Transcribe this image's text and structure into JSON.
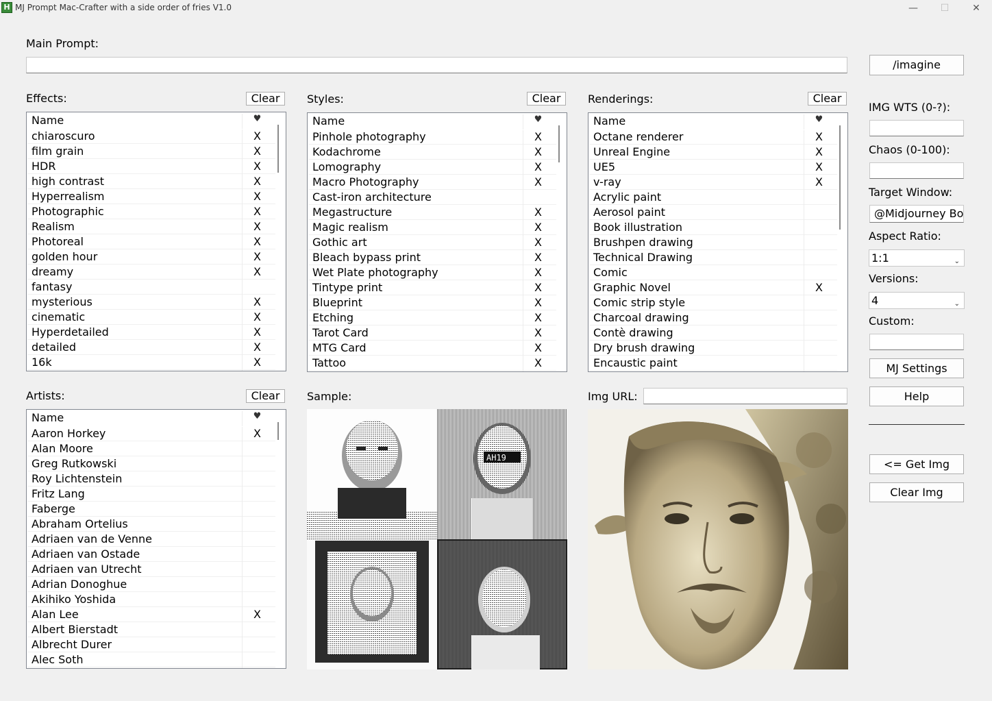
{
  "window": {
    "title": "MJ Prompt Mac-Crafter with a side order of fries V1.0",
    "icon_letter": "H",
    "min_glyph": "—",
    "max_glyph": "☐",
    "close_glyph": "✕"
  },
  "main_prompt": {
    "label": "Main Prompt:",
    "value": ""
  },
  "imagine_label": "/imagine",
  "effects": {
    "label": "Effects:",
    "clear_label": "Clear",
    "header_name": "Name",
    "header_fav": "♥",
    "rows": [
      {
        "name": "chiaroscuro",
        "fav": "X"
      },
      {
        "name": "film grain",
        "fav": "X"
      },
      {
        "name": "HDR",
        "fav": "X"
      },
      {
        "name": "high contrast",
        "fav": "X"
      },
      {
        "name": "Hyperrealism",
        "fav": "X"
      },
      {
        "name": "Photographic",
        "fav": "X"
      },
      {
        "name": "Realism",
        "fav": "X"
      },
      {
        "name": "Photoreal",
        "fav": "X"
      },
      {
        "name": "golden hour",
        "fav": "X"
      },
      {
        "name": "dreamy",
        "fav": "X"
      },
      {
        "name": "fantasy",
        "fav": ""
      },
      {
        "name": "mysterious",
        "fav": "X"
      },
      {
        "name": "cinematic",
        "fav": "X"
      },
      {
        "name": "Hyperdetailed",
        "fav": "X"
      },
      {
        "name": "detailed",
        "fav": "X"
      },
      {
        "name": "16k",
        "fav": "X"
      }
    ]
  },
  "styles": {
    "label": "Styles:",
    "clear_label": "Clear",
    "header_name": "Name",
    "header_fav": "♥",
    "rows": [
      {
        "name": "Pinhole photography",
        "fav": "X"
      },
      {
        "name": "Kodachrome",
        "fav": "X"
      },
      {
        "name": "Lomography",
        "fav": "X"
      },
      {
        "name": "Macro Photography",
        "fav": "X"
      },
      {
        "name": "Cast-iron architecture",
        "fav": ""
      },
      {
        "name": "Megastructure",
        "fav": "X"
      },
      {
        "name": "Magic realism",
        "fav": "X"
      },
      {
        "name": "Gothic art",
        "fav": "X"
      },
      {
        "name": "Bleach bypass print",
        "fav": "X"
      },
      {
        "name": "Wet Plate photography",
        "fav": "X"
      },
      {
        "name": "Tintype print",
        "fav": "X"
      },
      {
        "name": "Blueprint",
        "fav": "X"
      },
      {
        "name": "Etching",
        "fav": "X"
      },
      {
        "name": "Tarot Card",
        "fav": "X"
      },
      {
        "name": "MTG Card",
        "fav": "X"
      },
      {
        "name": "Tattoo",
        "fav": "X"
      }
    ]
  },
  "renderings": {
    "label": "Renderings:",
    "clear_label": "Clear",
    "header_name": "Name",
    "header_fav": "♥",
    "rows": [
      {
        "name": "Octane renderer",
        "fav": "X"
      },
      {
        "name": "Unreal Engine",
        "fav": "X"
      },
      {
        "name": "UE5",
        "fav": "X"
      },
      {
        "name": "v-ray",
        "fav": "X"
      },
      {
        "name": "Acrylic paint",
        "fav": ""
      },
      {
        "name": "Aerosol paint",
        "fav": ""
      },
      {
        "name": "Book illustration",
        "fav": ""
      },
      {
        "name": "Brushpen drawing",
        "fav": ""
      },
      {
        "name": "Technical Drawing",
        "fav": ""
      },
      {
        "name": "Comic",
        "fav": ""
      },
      {
        "name": "Graphic Novel",
        "fav": "X"
      },
      {
        "name": "Comic strip style",
        "fav": ""
      },
      {
        "name": "Charcoal drawing",
        "fav": ""
      },
      {
        "name": "Contè drawing",
        "fav": ""
      },
      {
        "name": "Dry brush drawing",
        "fav": ""
      },
      {
        "name": "Encaustic paint",
        "fav": ""
      }
    ]
  },
  "artists": {
    "label": "Artists:",
    "clear_label": "Clear",
    "header_name": "Name",
    "header_fav": "♥",
    "rows": [
      {
        "name": "Aaron Horkey",
        "fav": "X"
      },
      {
        "name": "Alan Moore",
        "fav": ""
      },
      {
        "name": "Greg Rutkowski",
        "fav": ""
      },
      {
        "name": "Roy Lichtenstein",
        "fav": ""
      },
      {
        "name": "Fritz Lang",
        "fav": ""
      },
      {
        "name": "Faberge",
        "fav": ""
      },
      {
        "name": "Abraham Ortelius",
        "fav": ""
      },
      {
        "name": "Adriaen van de Venne",
        "fav": ""
      },
      {
        "name": "Adriaen van Ostade",
        "fav": ""
      },
      {
        "name": "Adriaen van Utrecht",
        "fav": ""
      },
      {
        "name": "Adrian Donoghue",
        "fav": ""
      },
      {
        "name": "Akihiko Yoshida",
        "fav": ""
      },
      {
        "name": "Alan Lee",
        "fav": "X"
      },
      {
        "name": "Albert Bierstadt",
        "fav": ""
      },
      {
        "name": "Albrecht Durer",
        "fav": ""
      },
      {
        "name": "Alec Soth",
        "fav": ""
      }
    ]
  },
  "sample": {
    "label": "Sample:"
  },
  "img_url": {
    "label": "Img URL:",
    "value": ""
  },
  "settings": {
    "img_wts_label": "IMG WTS (0-?):",
    "img_wts_value": "",
    "chaos_label": "Chaos (0-100):",
    "chaos_value": "",
    "target_window_label": "Target Window:",
    "target_window_value": "@Midjourney Bot",
    "aspect_ratio_label": "Aspect Ratio:",
    "aspect_ratio_value": "1:1",
    "versions_label": "Versions:",
    "versions_value": "4",
    "custom_label": "Custom:",
    "custom_value": "",
    "mj_settings_label": "MJ Settings",
    "help_label": "Help",
    "get_img_label": "<= Get Img",
    "clear_img_label": "Clear Img"
  },
  "colors": {
    "bg": "#f0f0f0",
    "list_bg": "#ffffff",
    "border": "#828790",
    "sepia": "#d9cfae"
  }
}
